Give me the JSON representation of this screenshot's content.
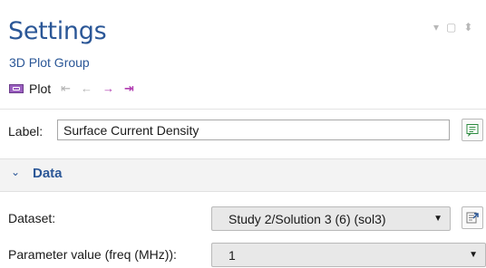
{
  "header": {
    "title": "Settings",
    "subtitle": "3D Plot Group"
  },
  "window_controls": {
    "menu": "▾",
    "restore": "▢",
    "pin": "⬍"
  },
  "toolbar": {
    "plot_label": "Plot",
    "first_glyph": "⇤",
    "prev_glyph": "←",
    "next_glyph": "→",
    "last_glyph": "⇥"
  },
  "label_field": {
    "label": "Label:",
    "value": "Surface Current Density"
  },
  "section": {
    "chevron": "⌄",
    "title": "Data"
  },
  "dataset": {
    "label": "Dataset:",
    "value": "Study 2/Solution 3 (6) (sol3)",
    "arrow": "▼"
  },
  "parameter": {
    "label": "Parameter value (freq (MHz)):",
    "value": "1",
    "arrow": "▼"
  },
  "colors": {
    "accent": "#2b5797",
    "nav_active": "#b03bb0",
    "nav_disabled": "#b0b0b0",
    "section_bg": "#f3f3f3"
  }
}
